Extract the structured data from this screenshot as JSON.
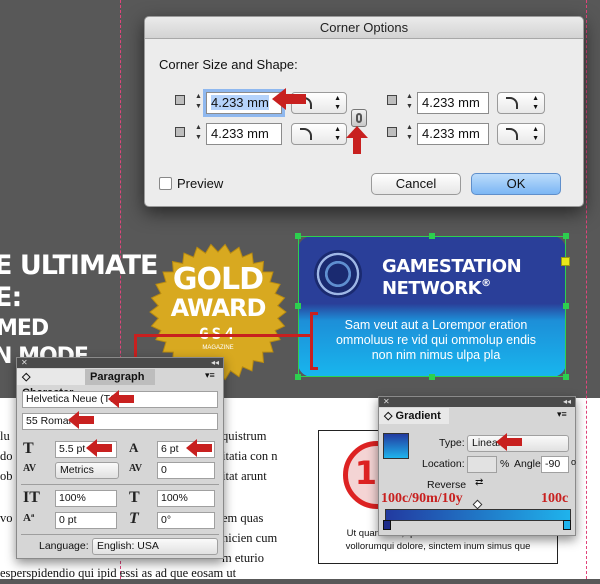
{
  "dialog": {
    "title": "Corner Options",
    "section_label": "Corner Size and Shape:",
    "corners": [
      {
        "value": "4.233 mm"
      },
      {
        "value": "4.233 mm"
      },
      {
        "value": "4.233 mm"
      },
      {
        "value": "4.233 mm"
      }
    ],
    "preview_label": "Preview",
    "cancel_label": "Cancel",
    "ok_label": "OK"
  },
  "document": {
    "headline_lines": [
      "E ULTIMATE",
      "E:",
      "MED",
      "N MODE"
    ],
    "award_line1": "GOLD",
    "award_line2": "AWARD",
    "award_logo": "GS4",
    "award_sub": "MAGAZINE",
    "body_lines": [
      "quistrum",
      "itatia con n",
      "itat arunt",
      "em quas",
      "hicien cum",
      "m eturio",
      "esperspidendio qui ipid essi as ad que eosam ut"
    ],
    "body_left_fragments": [
      "lu",
      "do",
      "ob",
      "vo"
    ]
  },
  "gamestation": {
    "brand_line1": "GAMESTATION",
    "brand_line2": "NETWORK",
    "registered": "®",
    "caption": [
      "Sam veut aut a Lorempor eration",
      "ommoluus re vid qui ommolup endis",
      "non nim nimus ulpa pla"
    ]
  },
  "rating_box": {
    "age": "18",
    "caption": [
      "Ut quam rent, quis aut velenim enam occus",
      "vollorumqui dolore, sinctem inum simus que"
    ]
  },
  "character_panel": {
    "tabs": [
      "Character",
      "Paragraph"
    ],
    "font_family": "Helvetica Neue (T1)",
    "font_style": "55 Roman",
    "font_size": "5.5 pt",
    "leading": "6 pt",
    "kerning": "Metrics",
    "tracking": "0",
    "vertical_scale": "100%",
    "horizontal_scale": "100%",
    "baseline_shift": "0 pt",
    "skew": "0°",
    "language_label": "Language:",
    "language": "English: USA"
  },
  "gradient_panel": {
    "title": "Gradient",
    "type_label": "Type:",
    "type_value": "Linear",
    "location_label": "Location:",
    "location_value": "",
    "location_unit": "%",
    "angle_label": "Angle:",
    "angle_value": "-90",
    "angle_unit": "o",
    "reverse_label": "Reverse",
    "stop_left_label": "100c/90m/10y",
    "stop_right_label": "100c"
  },
  "colors": {
    "ok_button": "#7bb6f4",
    "annotation_red": "#c8201f",
    "gold": "#d8a920",
    "gamestation_blue": "#2a3f99",
    "gamestation_cyan": "#18b6ee"
  }
}
